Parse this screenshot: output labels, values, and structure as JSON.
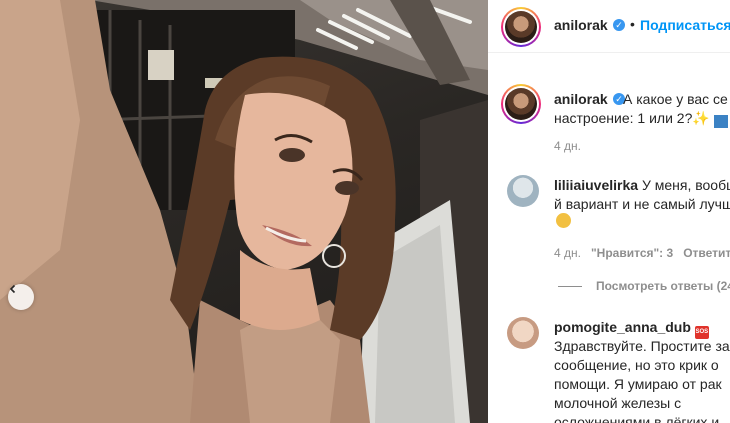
{
  "post": {
    "author": "anilorak",
    "follow_label": "Подписаться",
    "separator": "•"
  },
  "caption": {
    "author": "anilorak",
    "text": "А какое у вас се\nнастроение: 1 или 2?",
    "time": "4 дн."
  },
  "comments": [
    {
      "author": "liliiaiuvelirka",
      "text_line1": "У меня, вообщ",
      "text_line2": "й вариант и не самый лучш",
      "time": "4 дн.",
      "likes": "\"Нравится\": 3",
      "reply": "Ответит"
    },
    {
      "author": "pomogite_anna_dub",
      "text": "Здравствуйте. Простите за\nсообщение, но это крик о\nпомощи. Я умираю от рак\nмолочной железы с\nосложнениями в лёгких и"
    }
  ],
  "view_replies": "Посмотреть ответы (24",
  "icons": {
    "prev": "chevron-left-icon",
    "verified": "verified-badge-icon",
    "sparkle": "sparkles-emoji",
    "arrow": "left-arrow-emoji",
    "sad": "sad-face-emoji",
    "sos": "sos-emoji"
  },
  "colors": {
    "link": "#0095f6",
    "verified": "#3897f0",
    "muted": "#8e8e8e",
    "text": "#262626"
  }
}
